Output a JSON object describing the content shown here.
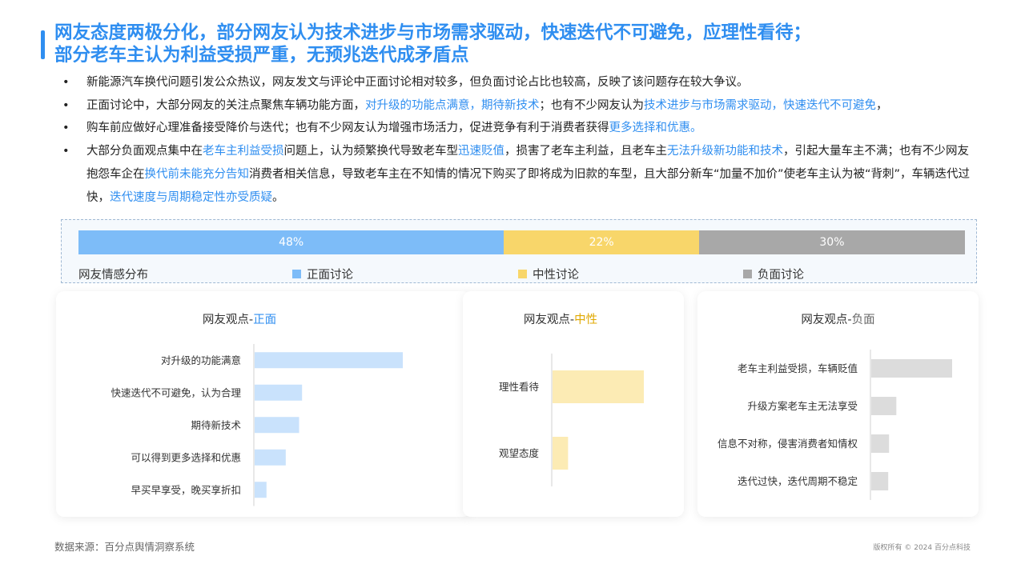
{
  "title": {
    "line1": "网友态度两极分化，部分网友认为技术进步与市场需求驱动，快速迭代不可避免，应理性看待；",
    "line2": "部分老车主认为利益受损严重，无预兆迭代成矛盾点"
  },
  "bullets": [
    [
      {
        "text": "新能源汽车换代问题引发公众热议，网友发文与评论中正面讨论相对较多，但负面讨论占比也较高，反映了该问题存在较大争议。",
        "hl": false
      }
    ],
    [
      {
        "text": "正面讨论中，大部分网友的关注点聚焦车辆功能方面，",
        "hl": false
      },
      {
        "text": "对升级的功能点满意，期待新技术",
        "hl": true
      },
      {
        "text": "；也有不少网友认为",
        "hl": false
      },
      {
        "text": "技术进步与市场需求驱动，快速迭代不可避免",
        "hl": true
      },
      {
        "text": "，",
        "hl": false
      }
    ],
    [
      {
        "text": "购车前应做好心理准备接受降价与迭代；也有不少网友认为增强市场活力，促进竞争有利于消费者获得",
        "hl": false
      },
      {
        "text": "更多选择和优惠。",
        "hl": true
      }
    ],
    [
      {
        "text": "大部分负面观点集中在",
        "hl": false
      },
      {
        "text": "老车主利益受损",
        "hl": true
      },
      {
        "text": "问题上，认为频繁换代导致老车型",
        "hl": false
      },
      {
        "text": "迅速贬值",
        "hl": true
      },
      {
        "text": "，损害了老车主利益，且老车主",
        "hl": false
      },
      {
        "text": "无法升级新功能和技术",
        "hl": true
      },
      {
        "text": "，引起大量车主不满；也有不少网友抱怨车企在",
        "hl": false
      },
      {
        "text": "换代前未能充分告知",
        "hl": true
      },
      {
        "text": "消费者相关信息，导致老车主在不知情的情况下购买了即将成为旧款的车型，且大部分新车“加量不加价”使老车主认为被“背刺”，车辆迭代过快，",
        "hl": false
      },
      {
        "text": "迭代速度与周期稳定性亦受质疑",
        "hl": true
      },
      {
        "text": "。",
        "hl": false
      }
    ]
  ],
  "colors": {
    "accent": "#2f8ef0",
    "positive_bar": "#7dbcf8",
    "neutral_bar": "#f8d66a",
    "negative_bar": "#a8a8a8",
    "positive_chart": "#c9e2fc",
    "neutral_chart": "#fcebb4",
    "negative_chart": "#dcdcdc",
    "neutral_accent": "#e0a800"
  },
  "distribution": {
    "label": "网友情感分布",
    "legend": [
      "正面讨论",
      "中性讨论",
      "负面讨论"
    ]
  },
  "chart_data": [
    {
      "type": "bar",
      "orientation": "horizontal-stacked",
      "categories": [
        "正面讨论",
        "中性讨论",
        "负面讨论"
      ],
      "values": [
        48,
        22,
        30
      ],
      "labels": [
        "48%",
        "22%",
        "30%"
      ],
      "title": "网友情感分布"
    },
    {
      "type": "bar",
      "orientation": "horizontal",
      "title_prefix": "网友观点-",
      "title_accent": "正面",
      "categories": [
        "对升级的功能满意",
        "快速迭代不可避免，认为合理",
        "期待新技术",
        "可以得到更多选择和优惠",
        "早买早享受，晚买享折扣"
      ],
      "values": [
        100,
        32,
        30,
        21,
        8
      ]
    },
    {
      "type": "bar",
      "orientation": "horizontal",
      "title_prefix": "网友观点-",
      "title_accent": "中性",
      "categories": [
        "理性看待",
        "观望态度"
      ],
      "values": [
        100,
        17
      ]
    },
    {
      "type": "bar",
      "orientation": "horizontal",
      "title_prefix": "网友观点-",
      "title_accent": "负面",
      "categories": [
        "老车主利益受损，车辆贬值",
        "升级方案老车主无法享受",
        "信息不对称，侵害消费者知情权",
        "迭代过快，迭代周期不稳定"
      ],
      "values": [
        100,
        31,
        22,
        21
      ]
    }
  ],
  "footer": {
    "source": "数据来源：百分点舆情洞察系统",
    "copyright": "版权所有 © 2024 百分点科技"
  }
}
